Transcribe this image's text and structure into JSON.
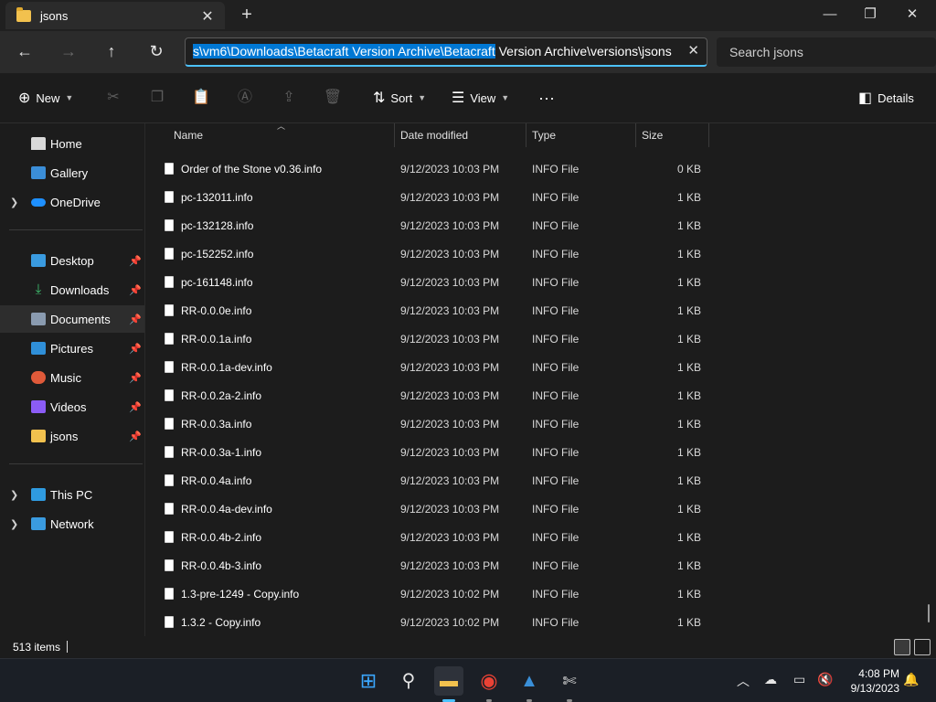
{
  "window": {
    "tab_title": "jsons",
    "tab_close": "✕",
    "new_tab": "+",
    "minimize": "—",
    "maximize": "❐",
    "close": "✕"
  },
  "nav": {
    "back": "←",
    "forward": "→",
    "up": "↑",
    "refresh": "↻",
    "address_selected": "s\\vm6\\Downloads\\Betacraft Version Archive\\Betacraft",
    "address_rest": " Version Archive\\versions\\jsons",
    "address_clear": "✕",
    "search_placeholder": "Search jsons"
  },
  "commands": {
    "new_label": "New",
    "sort_label": "Sort",
    "view_label": "View",
    "more_label": "···",
    "details_label": "Details"
  },
  "sidebar": {
    "items": [
      {
        "label": "Home",
        "icon": "home-icon"
      },
      {
        "label": "Gallery",
        "icon": "gallery-icon"
      },
      {
        "label": "OneDrive",
        "icon": "onedrive-icon"
      },
      {
        "label": "Desktop",
        "icon": "desktop-icon"
      },
      {
        "label": "Downloads",
        "icon": "downloads-icon"
      },
      {
        "label": "Documents",
        "icon": "documents-icon"
      },
      {
        "label": "Pictures",
        "icon": "pictures-icon"
      },
      {
        "label": "Music",
        "icon": "music-icon"
      },
      {
        "label": "Videos",
        "icon": "videos-icon"
      },
      {
        "label": "jsons",
        "icon": "folder-icon"
      },
      {
        "label": "This PC",
        "icon": "this-pc-icon"
      },
      {
        "label": "Network",
        "icon": "network-icon"
      }
    ]
  },
  "columns": {
    "name": "Name",
    "date": "Date modified",
    "type": "Type",
    "size": "Size"
  },
  "files": [
    {
      "name": "Order of the Stone v0.36.info",
      "date": "9/12/2023 10:03 PM",
      "type": "INFO File",
      "size": "0 KB"
    },
    {
      "name": "pc-132011.info",
      "date": "9/12/2023 10:03 PM",
      "type": "INFO File",
      "size": "1 KB"
    },
    {
      "name": "pc-132128.info",
      "date": "9/12/2023 10:03 PM",
      "type": "INFO File",
      "size": "1 KB"
    },
    {
      "name": "pc-152252.info",
      "date": "9/12/2023 10:03 PM",
      "type": "INFO File",
      "size": "1 KB"
    },
    {
      "name": "pc-161148.info",
      "date": "9/12/2023 10:03 PM",
      "type": "INFO File",
      "size": "1 KB"
    },
    {
      "name": "RR-0.0.0e.info",
      "date": "9/12/2023 10:03 PM",
      "type": "INFO File",
      "size": "1 KB"
    },
    {
      "name": "RR-0.0.1a.info",
      "date": "9/12/2023 10:03 PM",
      "type": "INFO File",
      "size": "1 KB"
    },
    {
      "name": "RR-0.0.1a-dev.info",
      "date": "9/12/2023 10:03 PM",
      "type": "INFO File",
      "size": "1 KB"
    },
    {
      "name": "RR-0.0.2a-2.info",
      "date": "9/12/2023 10:03 PM",
      "type": "INFO File",
      "size": "1 KB"
    },
    {
      "name": "RR-0.0.3a.info",
      "date": "9/12/2023 10:03 PM",
      "type": "INFO File",
      "size": "1 KB"
    },
    {
      "name": "RR-0.0.3a-1.info",
      "date": "9/12/2023 10:03 PM",
      "type": "INFO File",
      "size": "1 KB"
    },
    {
      "name": "RR-0.0.4a.info",
      "date": "9/12/2023 10:03 PM",
      "type": "INFO File",
      "size": "1 KB"
    },
    {
      "name": "RR-0.0.4a-dev.info",
      "date": "9/12/2023 10:03 PM",
      "type": "INFO File",
      "size": "1 KB"
    },
    {
      "name": "RR-0.0.4b-2.info",
      "date": "9/12/2023 10:03 PM",
      "type": "INFO File",
      "size": "1 KB"
    },
    {
      "name": "RR-0.0.4b-3.info",
      "date": "9/12/2023 10:03 PM",
      "type": "INFO File",
      "size": "1 KB"
    },
    {
      "name": "1.3-pre-1249 - Copy.info",
      "date": "9/12/2023 10:02 PM",
      "type": "INFO File",
      "size": "1 KB"
    },
    {
      "name": "1.3.2 - Copy.info",
      "date": "9/12/2023 10:02 PM",
      "type": "INFO File",
      "size": "1 KB"
    }
  ],
  "status": {
    "item_count": "513 items"
  },
  "taskbar": {
    "time": "4:08 PM",
    "date": "9/13/2023"
  },
  "colors": {
    "accent": "#0078d4",
    "focus_underline": "#4cc2ff",
    "folder": "#f2c14e"
  }
}
